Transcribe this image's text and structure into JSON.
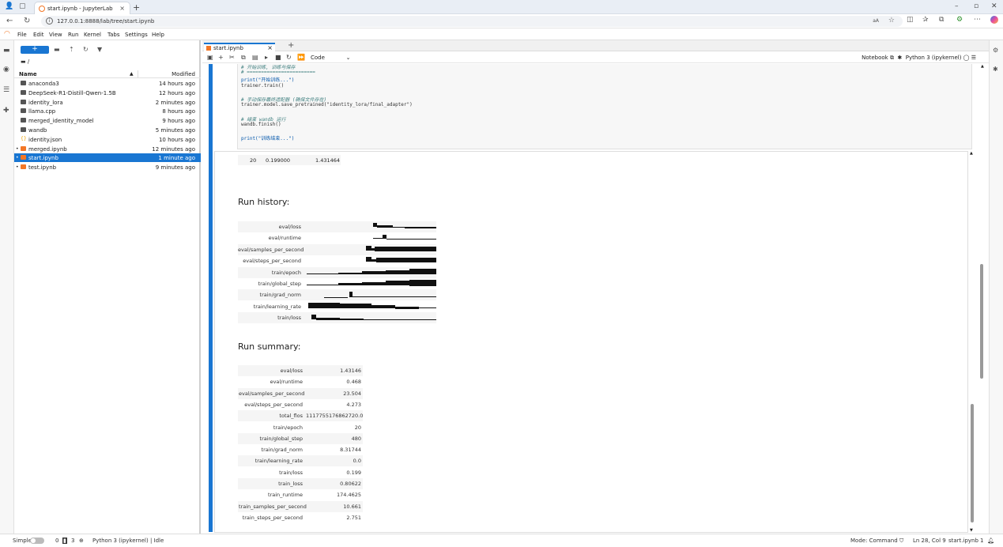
{
  "browser": {
    "tab_title": "start.ipynb - JupyterLab",
    "url": "127.0.0.1:8888/lab/tree/start.ipynb",
    "icons": [
      "back-icon",
      "forward-icon",
      "reload-icon",
      "info-icon",
      "reader-icon",
      "star-icon",
      "split-icon",
      "favorites-icon",
      "collections-icon",
      "extensions-icon",
      "more-icon",
      "copilot-icon"
    ]
  },
  "menu": [
    "File",
    "Edit",
    "View",
    "Run",
    "Kernel",
    "Tabs",
    "Settings",
    "Help"
  ],
  "filebrowser": {
    "new_label": "+",
    "breadcrumb": "/",
    "col_name": "Name",
    "col_modified": "Modified",
    "files": [
      {
        "name": "anaconda3",
        "modified": "14 hours ago",
        "type": "folder"
      },
      {
        "name": "DeepSeek-R1-Distill-Qwen-1.5B",
        "modified": "12 hours ago",
        "type": "folder"
      },
      {
        "name": "identity_lora",
        "modified": "2 minutes ago",
        "type": "folder"
      },
      {
        "name": "llama.cpp",
        "modified": "8 hours ago",
        "type": "folder"
      },
      {
        "name": "merged_identity_model",
        "modified": "9 hours ago",
        "type": "folder"
      },
      {
        "name": "wandb",
        "modified": "5 minutes ago",
        "type": "folder"
      },
      {
        "name": "identity.json",
        "modified": "10 hours ago",
        "type": "json"
      },
      {
        "name": "merged.ipynb",
        "modified": "12 minutes ago",
        "type": "nb"
      },
      {
        "name": "start.ipynb",
        "modified": "1 minute ago",
        "type": "nb"
      },
      {
        "name": "test.ipynb",
        "modified": "9 minutes ago",
        "type": "nb"
      }
    ]
  },
  "notebook": {
    "tab": "start.ipynb",
    "cell_type": "Code",
    "notebook_label": "Notebook",
    "kernel": "Python 3 (ipykernel)",
    "code_lines": [
      {
        "t": "# 开始训练, 训练与保存",
        "c": "cmt"
      },
      {
        "t": "# ========================",
        "c": "cmt"
      },
      {
        "t": "print(\"开始训练...\")",
        "c": "fn"
      },
      {
        "t": "trainer.train()",
        "c": "kw"
      },
      {
        "t": "",
        "c": "kw"
      },
      {
        "t": "# 手动保存最终适配器 (确保文件存在)",
        "c": "cmt"
      },
      {
        "t": "trainer.model.save_pretrained(\"identity_lora/final_adapter\")",
        "c": "kw"
      },
      {
        "t": "",
        "c": "kw"
      },
      {
        "t": "# 结束 wandb 运行",
        "c": "cmt"
      },
      {
        "t": "wandb.finish()",
        "c": "kw"
      },
      {
        "t": "",
        "c": "kw"
      },
      {
        "t": "print(\"训练结束...\")",
        "c": "fn"
      }
    ],
    "table_last_row": [
      "20",
      "0.199000",
      "1.431464"
    ],
    "run_history_title": "Run history:",
    "run_history": [
      "eval/loss",
      "eval/runtime",
      "eval/samples_per_second",
      "eval/steps_per_second",
      "train/epoch",
      "train/global_step",
      "train/grad_norm",
      "train/learning_rate",
      "train/loss"
    ],
    "run_summary_title": "Run summary:",
    "run_summary": [
      {
        "k": "eval/loss",
        "v": "1.43146"
      },
      {
        "k": "eval/runtime",
        "v": "0.468"
      },
      {
        "k": "eval/samples_per_second",
        "v": "23.504"
      },
      {
        "k": "eval/steps_per_second",
        "v": "4.273"
      },
      {
        "k": "total_flos",
        "v": "1117755176862720.0"
      },
      {
        "k": "train/epoch",
        "v": "20"
      },
      {
        "k": "train/global_step",
        "v": "480"
      },
      {
        "k": "train/grad_norm",
        "v": "8.31744"
      },
      {
        "k": "train/learning_rate",
        "v": "0.0"
      },
      {
        "k": "train/loss",
        "v": "0.199"
      },
      {
        "k": "train_loss",
        "v": "0.80622"
      },
      {
        "k": "train_runtime",
        "v": "174.4625"
      },
      {
        "k": "train_samples_per_second",
        "v": "10.661"
      },
      {
        "k": "train_steps_per_second",
        "v": "2.751"
      }
    ]
  },
  "status": {
    "mode_simple": "Simple",
    "count0": "0",
    "count1": "3",
    "kernel_status": "Python 3 (ipykernel) | Idle",
    "mode": "Mode: Command",
    "cursor": "Ln 28, Col 9",
    "file": "start.ipynb",
    "notif": "1"
  },
  "colors": {
    "accent": "#1976d2",
    "notebook": "#f37726"
  }
}
